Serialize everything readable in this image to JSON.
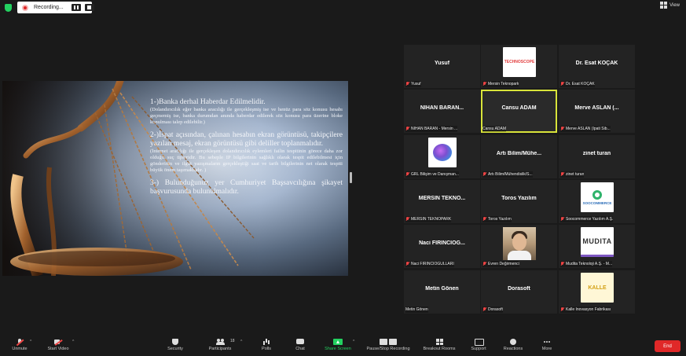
{
  "recording": {
    "label": "Recording..."
  },
  "view": {
    "label": "View"
  },
  "slide": {
    "items": [
      {
        "heading": "1-)Banka derhal Haberdar Edilmelidir.",
        "detail": "(Dolandırıcılık eğer banka aracılığı ile gerçekleşmiş ise ve henüz para söz konusu hesabı geçmemiş ise, banka durumdan anında haberdar edilerek söz konusu para üzerine bloke konulması talep edilebilir.)"
      },
      {
        "heading": "2-)İspat açısından, çalınan hesabın ekran görüntüsü, takipçilere yazılan mesaj, ekran görüntüsü gibi deliller toplanmalıdır.",
        "detail": "(İnternet aracılığı ile gerçekleşen dolandırıcılık eylemleri failin tespitinin görece daha zor olduğu suç tipleridir. Bu sebeple IP bilgilerinin sağlıklı olarak tespit edilebilmesi için gönderinin ve ilgili yazışmaların gerçekleştiği saat ve tarih bilgilerinin net olarak tespiti büyük önem taşımaktadır. )"
      },
      {
        "heading": "3-) Bulunduğunuz yer Cumhuriyet Başsavcılığına şikayet başvurusunda bulunulmalıdır.",
        "detail": ""
      }
    ]
  },
  "participants": [
    {
      "big": "Yusuf",
      "name": "Yusuf"
    },
    {
      "logo": "TECHNOSCOPE",
      "name": "Mersin Teknopark"
    },
    {
      "big": "Dr. Esat KOÇAK",
      "name": "Dr. Esat KOÇAK"
    },
    {
      "big": "NİHAN BARAN...",
      "name": "NİHAN BARAN - Mersin ..."
    },
    {
      "big": "Cansu ADAM",
      "name": "Cansu ADAM",
      "speaking": true
    },
    {
      "big": "Merve ASLAN (...",
      "name": "Merve ASLAN (Ipati Sib..."
    },
    {
      "logo": "GRL",
      "name": "GRL Bilişim ve Danışman..."
    },
    {
      "big": "Artı Bilim/Mühe...",
      "name": "Artı Bilim/Mühendislik/S..."
    },
    {
      "big": "zinet turan",
      "name": "zinet turan"
    },
    {
      "big": "MERSİN TEKNO...",
      "name": "MERSİN TEKNOPARK"
    },
    {
      "big": "Toros Yazılım",
      "name": "Toros Yazılım"
    },
    {
      "logo": "SOOCOMMERCE",
      "name": "Soocommerce Yazılım A.Ş."
    },
    {
      "big": "Naci FIRINCIOĞ...",
      "name": "Naci FIRINCIOĞULLARI"
    },
    {
      "photo": true,
      "name": "Evren Değirmenci"
    },
    {
      "logo": "MUDITA",
      "name": "Mudita Teknoloji A.Ş. - M..."
    },
    {
      "big": "Metin Gönen",
      "name": "Metin Gönen"
    },
    {
      "big": "Dorasoft",
      "name": "Dorasoft"
    },
    {
      "logo": "KALLE",
      "name": "Kalle İnovasyon Fabrikası"
    }
  ],
  "toolbar": {
    "unmute": "Unmute",
    "start_video": "Start Video",
    "security": "Security",
    "participants": "Participants",
    "participants_count": "18",
    "polls": "Polls",
    "chat": "Chat",
    "share_screen": "Share Screen",
    "pause_stop_recording": "Pause/Stop Recording",
    "breakout_rooms": "Breakout Rooms",
    "support": "Support",
    "reactions": "Reactions",
    "more": "More",
    "end": "End"
  }
}
